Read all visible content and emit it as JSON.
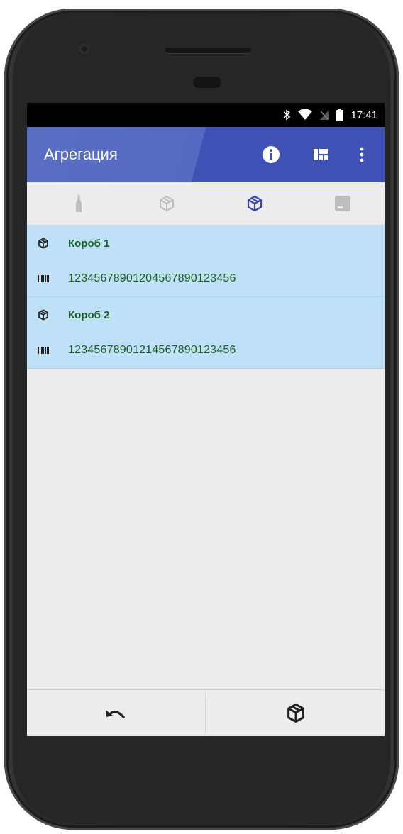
{
  "status_bar": {
    "time": "17:41",
    "icons": [
      "bluetooth-icon",
      "wifi-icon",
      "no-sim-icon",
      "battery-icon"
    ]
  },
  "app_bar": {
    "title": "Агрегация",
    "actions": [
      "info-icon",
      "layout-icon",
      "more-vert-icon"
    ],
    "color": "#3f51b5"
  },
  "tabs": [
    {
      "icon": "bottle-icon",
      "active": false
    },
    {
      "icon": "open-box-icon",
      "active": false
    },
    {
      "icon": "box-icon",
      "active": true
    },
    {
      "icon": "pallet-icon",
      "active": false
    }
  ],
  "items": [
    {
      "title": "Короб 1",
      "code": "12345678901204567890123456"
    },
    {
      "title": "Короб 2",
      "code": "12345678901214567890123456"
    }
  ],
  "bottom_bar": {
    "left": "undo-icon",
    "right": "add-box-icon"
  },
  "colors": {
    "item_bg": "#bfe1f7",
    "item_text": "#1b5e20",
    "accent": "#3949ab"
  }
}
